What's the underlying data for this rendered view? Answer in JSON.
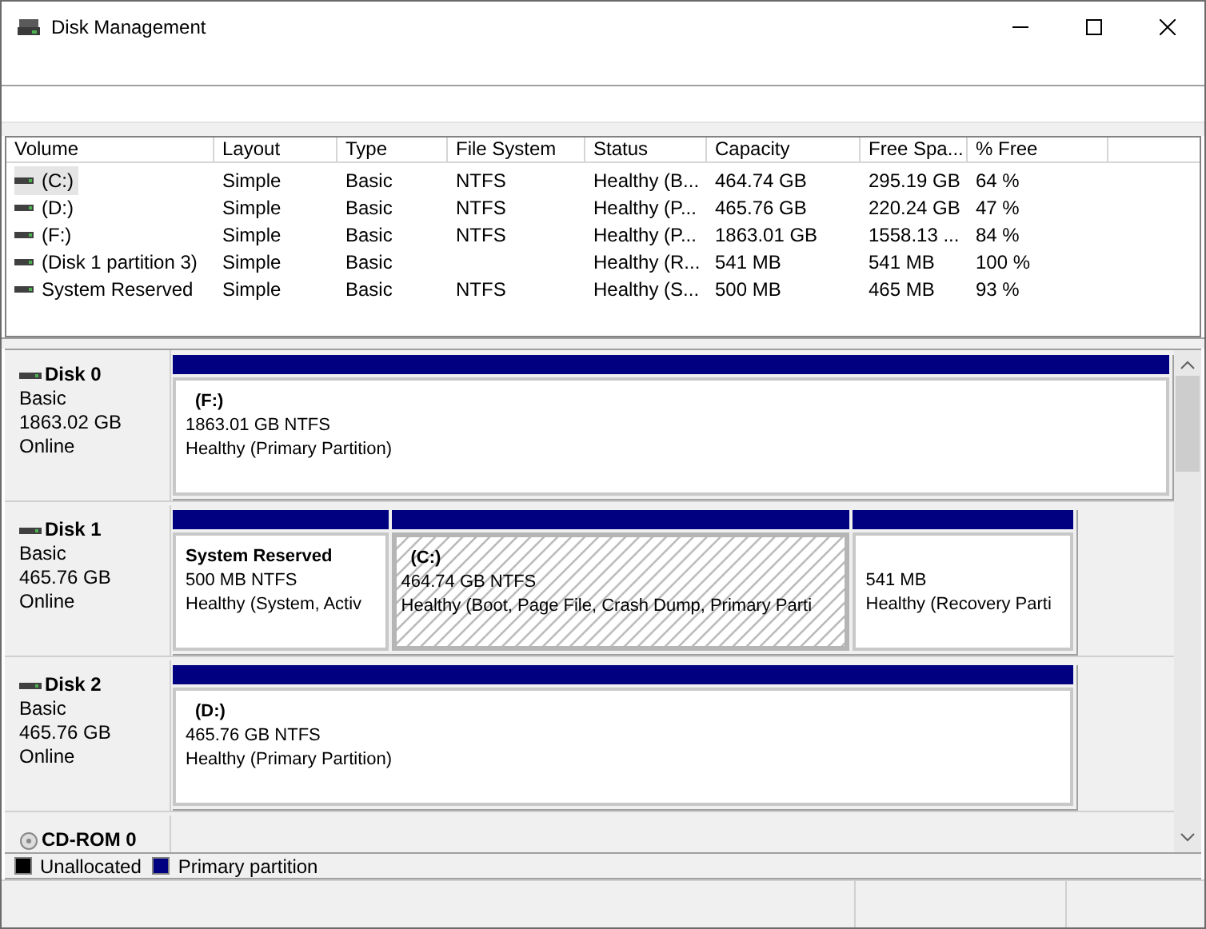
{
  "window": {
    "title": "Disk Management"
  },
  "volume_list": {
    "columns": [
      "Volume",
      "Layout",
      "Type",
      "File System",
      "Status",
      "Capacity",
      "Free Spa...",
      "% Free"
    ],
    "rows": [
      {
        "cells": [
          "(C:)",
          "Simple",
          "Basic",
          "NTFS",
          "Healthy (B...",
          "464.74 GB",
          "295.19 GB",
          "64 %"
        ],
        "selected": true
      },
      {
        "cells": [
          "(D:)",
          "Simple",
          "Basic",
          "NTFS",
          "Healthy (P...",
          "465.76 GB",
          "220.24 GB",
          "47 %"
        ],
        "selected": false
      },
      {
        "cells": [
          "(F:)",
          "Simple",
          "Basic",
          "NTFS",
          "Healthy (P...",
          "1863.01 GB",
          "1558.13 ...",
          "84 %"
        ],
        "selected": false
      },
      {
        "cells": [
          "(Disk 1 partition 3)",
          "Simple",
          "Basic",
          "",
          "Healthy (R...",
          "541 MB",
          "541 MB",
          "100 %"
        ],
        "selected": false
      },
      {
        "cells": [
          "System Reserved",
          "Simple",
          "Basic",
          "NTFS",
          "Healthy (S...",
          "500 MB",
          "465 MB",
          "93 %"
        ],
        "selected": false
      }
    ]
  },
  "disks": [
    {
      "kind": "disk",
      "name": "Disk 0",
      "type": "Basic",
      "size": "1863.02 GB",
      "status": "Online",
      "partitions": [
        {
          "label": "(F:)",
          "size": "1863.01 GB NTFS",
          "status": "Healthy (Primary Partition)",
          "selected": false
        }
      ]
    },
    {
      "kind": "disk",
      "name": "Disk 1",
      "type": "Basic",
      "size": "465.76 GB",
      "status": "Online",
      "partitions": [
        {
          "label": "System Reserved",
          "size": "500 MB NTFS",
          "status": "Healthy (System, Activ",
          "selected": false
        },
        {
          "label": "(C:)",
          "size": "464.74 GB NTFS",
          "status": "Healthy (Boot, Page File, Crash Dump, Primary Parti",
          "selected": true
        },
        {
          "size": "541 MB",
          "status": "Healthy (Recovery Parti",
          "selected": false
        }
      ]
    },
    {
      "kind": "disk",
      "name": "Disk 2",
      "type": "Basic",
      "size": "465.76 GB",
      "status": "Online",
      "partitions": [
        {
          "label": "(D:)",
          "size": "465.76 GB NTFS",
          "status": "Healthy (Primary Partition)",
          "selected": false
        }
      ]
    },
    {
      "kind": "cdrom",
      "name": "CD-ROM 0"
    }
  ],
  "legend": [
    {
      "label": "Unallocated",
      "color": "#000000"
    },
    {
      "label": "Primary partition",
      "color": "#000080"
    }
  ]
}
